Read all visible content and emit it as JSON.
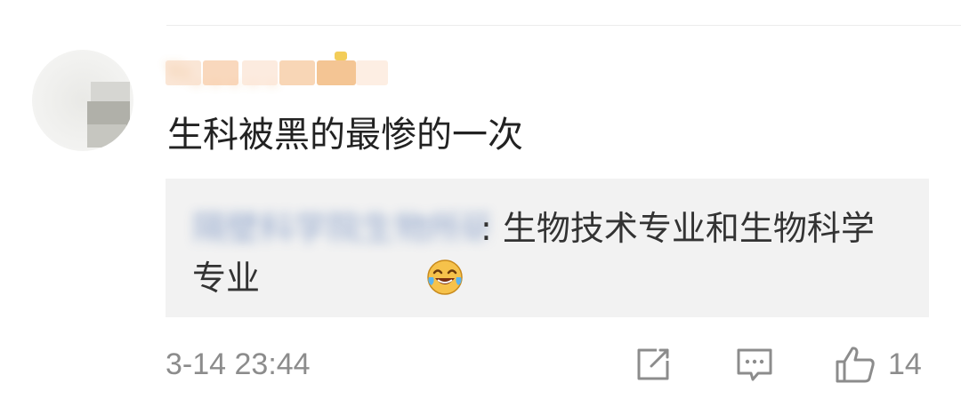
{
  "post": {
    "username": "Yo_ _ _ _ _",
    "comment": "生科被黑的最惨的一次",
    "quote": {
      "author": "隔壁科学院生物所研究员",
      "text_line1": ": 生物技术专业和生物科学",
      "text_line2": "专业",
      "emoji": "laughing-crying-emoji"
    },
    "timestamp": "3-14 23:44",
    "actions": {
      "share_icon": "share-icon",
      "comment_icon": "comment-icon",
      "like_icon": "thumbs-up-icon",
      "like_count": "14"
    }
  },
  "colors": {
    "accent_name": "#f0a653",
    "quote_author": "#5477b4",
    "quote_bg": "#f2f2f2",
    "meta_text": "#8c8c8c"
  }
}
